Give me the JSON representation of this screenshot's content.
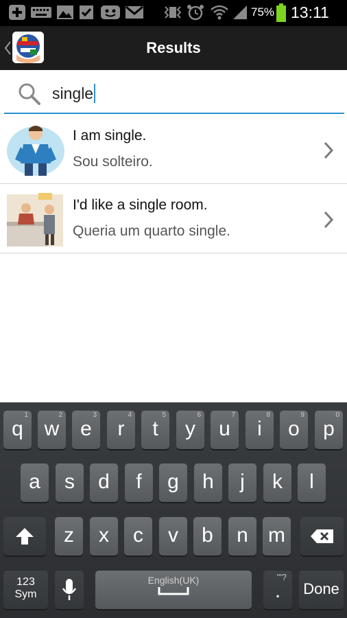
{
  "status_bar": {
    "battery_percent": "75%",
    "time": "13:11"
  },
  "action_bar": {
    "title": "Results"
  },
  "search": {
    "query": "single"
  },
  "results": [
    {
      "english": "I am single.",
      "portuguese": "Sou solteiro."
    },
    {
      "english": "I'd like a single room.",
      "portuguese": "Queria um quarto single."
    }
  ],
  "keyboard": {
    "row1": [
      {
        "letter": "q",
        "num": "1"
      },
      {
        "letter": "w",
        "num": "2"
      },
      {
        "letter": "e",
        "num": "3"
      },
      {
        "letter": "r",
        "num": "4"
      },
      {
        "letter": "t",
        "num": "5"
      },
      {
        "letter": "y",
        "num": "6"
      },
      {
        "letter": "u",
        "num": "7"
      },
      {
        "letter": "i",
        "num": "8"
      },
      {
        "letter": "o",
        "num": "9"
      },
      {
        "letter": "p",
        "num": "0"
      }
    ],
    "row2": [
      "a",
      "s",
      "d",
      "f",
      "g",
      "h",
      "j",
      "k",
      "l"
    ],
    "row3": [
      "z",
      "x",
      "c",
      "v",
      "b",
      "n",
      "m"
    ],
    "sym_top": "123",
    "sym_bottom": "Sym",
    "space_label": "English(UK)",
    "period": ".",
    "period_alt": "'\"?",
    "done": "Done"
  },
  "colors": {
    "accent": "#2a8fd0",
    "action_bar": "#1d1d1d",
    "battery": "#7ed321"
  }
}
